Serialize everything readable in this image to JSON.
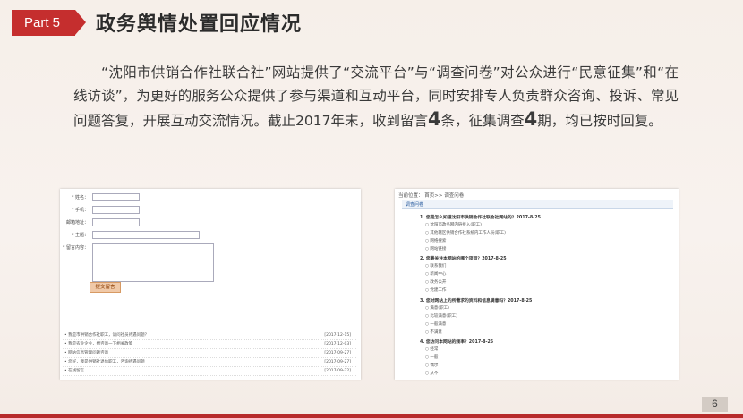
{
  "header": {
    "badge": "Part 5",
    "title": "政务舆情处置回应情况"
  },
  "paragraph": {
    "p1": "“沈阳市供销合作社联合社”网站提供了“交流平台”与“调查问卷”对公众进行“民意征集”和“在线访谈”，为更好的服务公众提供了参与渠道和互动平台，同时安排专人负责群众咨询、投诉、常见问题答复，开展互动交流情况。截止2017年末，收到留言",
    "n1": "4",
    "p2": "条，征集调查",
    "n2": "4",
    "p3": "期，均已按时回复。"
  },
  "form_shot": {
    "fields": [
      "* 姓名：",
      "* 手机：",
      "邮箱地址：",
      "* 主题：",
      "* 留言内容："
    ],
    "submit": "提交留言",
    "rows": [
      {
        "t": "• 我是市供销合作社职工，请问社员待遇问题？",
        "d": "[2017-12-15]"
      },
      {
        "t": "• 我是农业企业，想咨询一下相关政策",
        "d": "[2017-12-03]"
      },
      {
        "t": "• 网站信息管理问题咨询",
        "d": "[2017-09-27]"
      },
      {
        "t": "• 您好，我是供销社退休职工，咨询待遇问题",
        "d": "[2017-09-27]"
      },
      {
        "t": "• 在线留言",
        "d": "[2017-09-22]"
      }
    ]
  },
  "survey_shot": {
    "breadcrumb": "当前位置： 首页>> 调查问卷",
    "tab": "调查问卷",
    "q1": "1. 您是怎么知道沈阳市供销合作社联合社网站的？2017-8-25",
    "q1_opts": [
      "沈阳市政务网内链接入(职工)",
      "其他辖区供销合作社系统内工作人员(职工)",
      "网络搜索",
      "网站链接"
    ],
    "q2": "2. 您最关注本网站的哪个项目？2017-8-25",
    "q2_opts": [
      "联系我们",
      "新闻中心",
      "政务公开",
      "党建工作"
    ],
    "q3": "3. 您对网站上的所需求的资料和信息满意吗？2017-8-25",
    "q3_opts": [
      "满意(职工)",
      "比较满意(职工)",
      "一般满意",
      "不满意"
    ],
    "q4": "4. 您访问本网站的频率？2017-8-25",
    "q4_opts": [
      "经常",
      "一般",
      "偶尔",
      "从不"
    ]
  },
  "page_number": "6"
}
